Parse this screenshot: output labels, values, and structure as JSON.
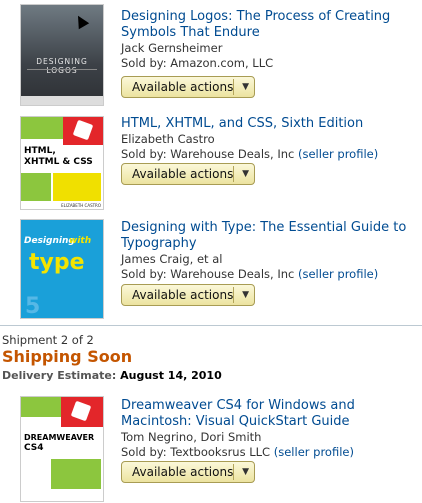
{
  "items_top": [
    {
      "title": "Designing Logos: The Process of Creating Symbols That Endure",
      "author": "Jack Gernsheimer",
      "sold_by_prefix": "Sold by: ",
      "seller": "Amazon.com, LLC",
      "seller_profile": "",
      "action": "Available actions"
    },
    {
      "title": "HTML, XHTML, and CSS, Sixth Edition",
      "author": "Elizabeth Castro",
      "sold_by_prefix": "Sold by: ",
      "seller": "Warehouse Deals, Inc",
      "seller_profile": "(seller profile)",
      "action": "Available actions"
    },
    {
      "title": "Designing with Type: The Essential Guide to Typography",
      "author": "James Craig, et al",
      "sold_by_prefix": "Sold by: ",
      "seller": "Warehouse Deals, Inc",
      "seller_profile": "(seller profile)",
      "action": "Available actions"
    }
  ],
  "shipment": {
    "label": "Shipment 2 of 2",
    "status": "Shipping Soon",
    "delivery_label": "Delivery Estimate:",
    "delivery_date": "August 14, 2010",
    "status_color": "#c45500"
  },
  "item_bottom": {
    "title": "Dreamweaver CS4 for Windows and Macintosh: Visual QuickStart Guide",
    "author": "Tom Negrino, Dori Smith",
    "sold_by_prefix": "Sold by: ",
    "seller": "Textbooksrus LLC",
    "seller_profile": "(seller profile)",
    "action": "Available actions"
  },
  "covers": {
    "designing_logos_text": "DESIGNING LOGOS",
    "html_text_1": "HTML,",
    "html_text_2": "XHTML & CSS",
    "html_author": "ELIZABETH CASTRO",
    "type_text_1": "Designing",
    "type_text_2": "with",
    "type_text_3": "type",
    "dw_text_1": "DREAMWEAVER",
    "dw_text_2": "CS4"
  },
  "colors": {
    "link": "#004b91",
    "accent_orange": "#c45500",
    "divider": "#bcc9d2"
  },
  "icons": {
    "dropdown": "chevron-down-icon"
  }
}
